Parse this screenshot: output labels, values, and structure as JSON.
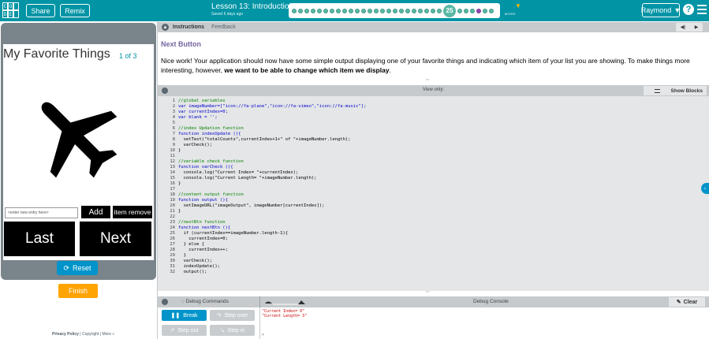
{
  "header": {
    "logo_letters": [
      "C",
      "O",
      "D",
      "E"
    ],
    "share_label": "Share",
    "remix_label": "Remix",
    "lesson_title": "Lesson 13: Introduction to Arrays",
    "saved_text": "Saved 6 days ago",
    "current_level": "25",
    "more_label": "MORE",
    "user_label": "Raymond",
    "help_label": "?"
  },
  "app": {
    "title": "My Favorite Things",
    "count": "1 of 3",
    "input_placeholder": "enter new entry here",
    "add_label": "Add",
    "remove_label": "item remove",
    "last_label": "Last",
    "next_label": "Next",
    "reset_label": "Reset",
    "finish_label": "Finish"
  },
  "footer": {
    "privacy": "Privacy Policy",
    "sep1": " | ",
    "copyright": "Copyright",
    "sep2": " | ",
    "more": "More »"
  },
  "instructions": {
    "tab_instructions": "Instructions",
    "tab_feedback": "Feedback",
    "heading": "Next Button",
    "text_before": "Nice work! Your application should now have some simple output displaying one of your favorite things and indicating which item of your list you are showing. To make things more interesting, however, ",
    "text_bold": "we want to be able to change which item we display",
    "text_after": "."
  },
  "workspace": {
    "title": "View only:",
    "show_blocks_label": "Show Blocks",
    "code_lines": [
      {
        "n": "1",
        "t": "//global variables"
      },
      {
        "n": "2",
        "t": "var imageNumber=[\"icon://fa-plane\",\"icon://fa-vimeo\",\"icon://fa-music\"];"
      },
      {
        "n": "3",
        "t": "var currentIndex=0;"
      },
      {
        "n": "4",
        "t": "var blank = '';"
      },
      {
        "n": "5",
        "t": ""
      },
      {
        "n": "6",
        "t": "//index Updation function"
      },
      {
        "n": "7",
        "t": "function indexUpdate (){"
      },
      {
        "n": "8",
        "t": "  setText(\"totalCounts\",currentIndex+1+\" of \"+imageNumber.length);"
      },
      {
        "n": "9",
        "t": "  varCheck();"
      },
      {
        "n": "10",
        "t": "}"
      },
      {
        "n": "11",
        "t": ""
      },
      {
        "n": "12",
        "t": "//variable check function"
      },
      {
        "n": "13",
        "t": "function varCheck (){"
      },
      {
        "n": "14",
        "t": "  console.log(\"Current Index= \"+currentIndex);"
      },
      {
        "n": "15",
        "t": "  console.log(\"Current Length= \"+imageNumber.length);"
      },
      {
        "n": "16",
        "t": "}"
      },
      {
        "n": "17",
        "t": ""
      },
      {
        "n": "18",
        "t": "//content output function"
      },
      {
        "n": "19",
        "t": "function output (){"
      },
      {
        "n": "20",
        "t": "  setImageURL(\"imageOutput\", imageNumber[currentIndex]);"
      },
      {
        "n": "21",
        "t": "}"
      },
      {
        "n": "22",
        "t": ""
      },
      {
        "n": "23",
        "t": "//nextBtn function"
      },
      {
        "n": "24",
        "t": "function nextBtn (){"
      },
      {
        "n": "25",
        "t": "  if (currentIndex==imageNumber.length-1){"
      },
      {
        "n": "26",
        "t": "    currentIndex=0;"
      },
      {
        "n": "27",
        "t": "  } else {"
      },
      {
        "n": "28",
        "t": "    currentIndex++;"
      },
      {
        "n": "29",
        "t": "  }"
      },
      {
        "n": "30",
        "t": "  varCheck();"
      },
      {
        "n": "31",
        "t": "  indexUpdate();"
      },
      {
        "n": "32",
        "t": "  output();"
      }
    ]
  },
  "debug": {
    "commands_label": "Debug Commands",
    "console_title": "Debug Console",
    "clear_label": "Clear",
    "break_label": "Break",
    "step_over_label": "Step over",
    "step_out_label": "Step out",
    "step_in_label": "Step in",
    "console_lines": "\"Current Index= 0\"\n\"Current Length= 3\"",
    "prompt": ">"
  },
  "colors": {
    "header_bg": "#0094a5",
    "accent_blue": "#0094ca",
    "finish_orange": "#ffa400",
    "heading_purple": "#7665a0"
  }
}
